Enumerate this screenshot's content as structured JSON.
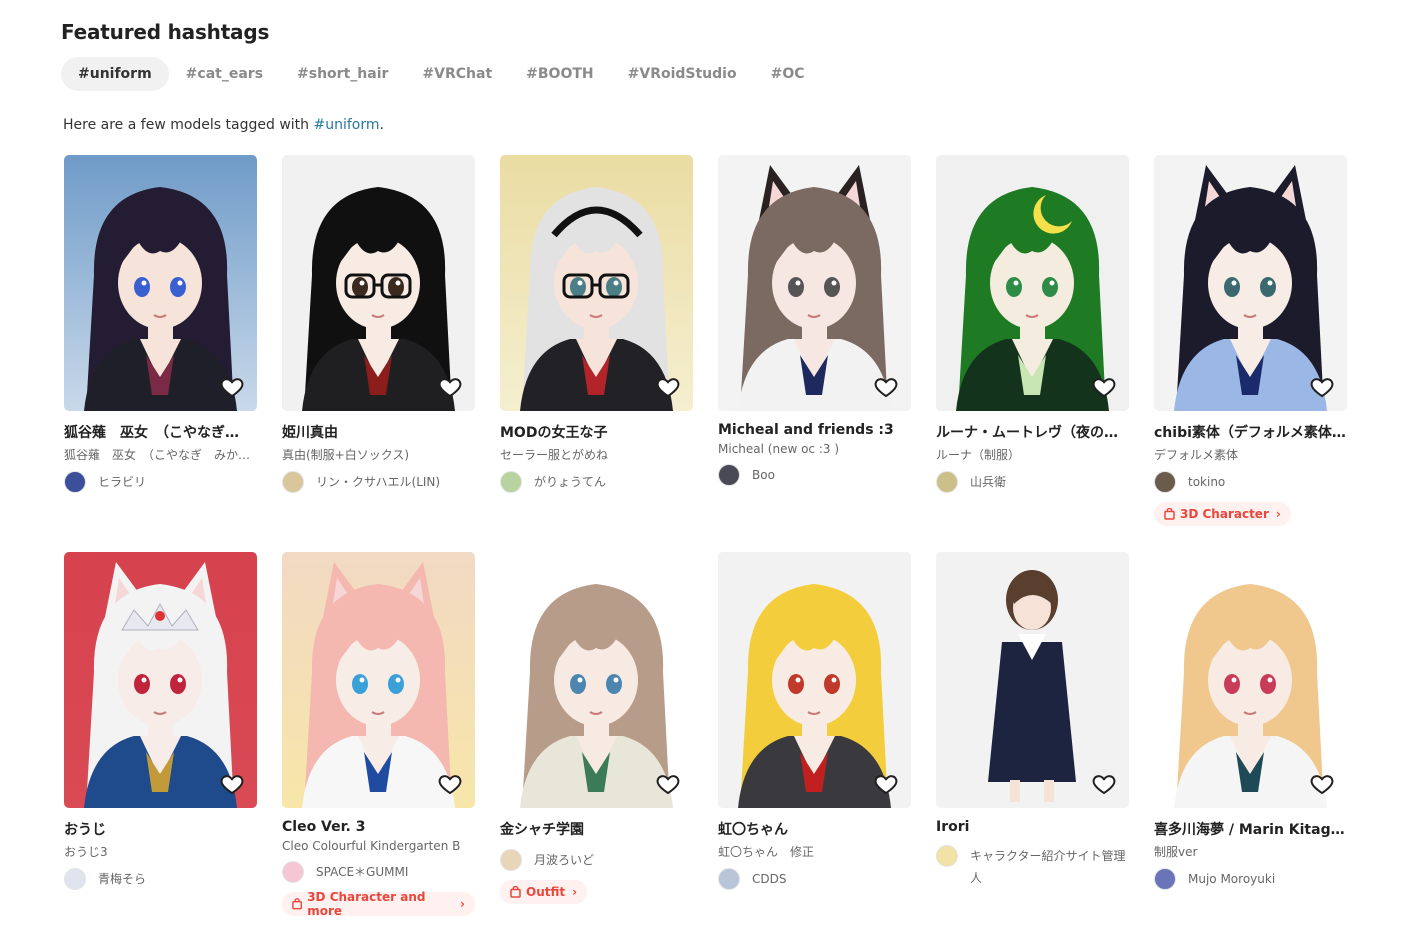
{
  "header": {
    "title": "Featured hashtags"
  },
  "tags": [
    "#uniform",
    "#cat_ears",
    "#short_hair",
    "#VRChat",
    "#BOOTH",
    "#VRoidStudio",
    "#OC"
  ],
  "active_tag": "#uniform",
  "intro": {
    "prefix": "Here are a few models tagged with ",
    "link": "#uniform",
    "suffix": "."
  },
  "colors": {
    "accent": "#27779e",
    "badge_text": "#e8473c",
    "badge_bg": "#fff1f0"
  },
  "models": [
    {
      "name": "狐谷薙　巫女　（こやなぎ…",
      "subtitle": "狐谷薙　巫女　（こやなぎ　みか…",
      "author": "ヒラビリ",
      "badge": ""
    },
    {
      "name": "姫川真由",
      "subtitle": "真由(制服+白ソックス)",
      "author": "リン・クサハエル(LIN)",
      "badge": ""
    },
    {
      "name": "MODの女王な子",
      "subtitle": "セーラー服とがめね",
      "author": "がりょうてん",
      "badge": ""
    },
    {
      "name": "Micheal and friends :3",
      "subtitle": "Micheal (new oc :3 )",
      "author": "Boo",
      "badge": ""
    },
    {
      "name": "ルーナ・ムートレヴ（夜の…",
      "subtitle": "ルーナ（制服）",
      "author": "山兵衛",
      "badge": ""
    },
    {
      "name": "chibi素体（デフォルメ素体…",
      "subtitle": "デフォルメ素体",
      "author": "tokino",
      "badge": "3D Character"
    },
    {
      "name": "おうじ",
      "subtitle": "おうじ3",
      "author": "青梅そら",
      "badge": ""
    },
    {
      "name": "Cleo Ver. 3",
      "subtitle": "Cleo Colourful Kindergarten B",
      "author": "SPACE＊GUMMI",
      "badge": "3D Character and more"
    },
    {
      "name": "金シャチ学園",
      "subtitle": "",
      "author": "月波ろいど",
      "badge": "Outfit"
    },
    {
      "name": "虹〇ちゃん",
      "subtitle": "虹〇ちゃん　修正",
      "author": "CDDS",
      "badge": ""
    },
    {
      "name": "Irori",
      "subtitle": "",
      "author": "キャラクター紹介サイト管理人",
      "badge": ""
    },
    {
      "name": "喜多川海夢 / Marin Kitagawa",
      "subtitle": "制服ver",
      "author": "Mujo Moroyuki",
      "badge": ""
    }
  ]
}
